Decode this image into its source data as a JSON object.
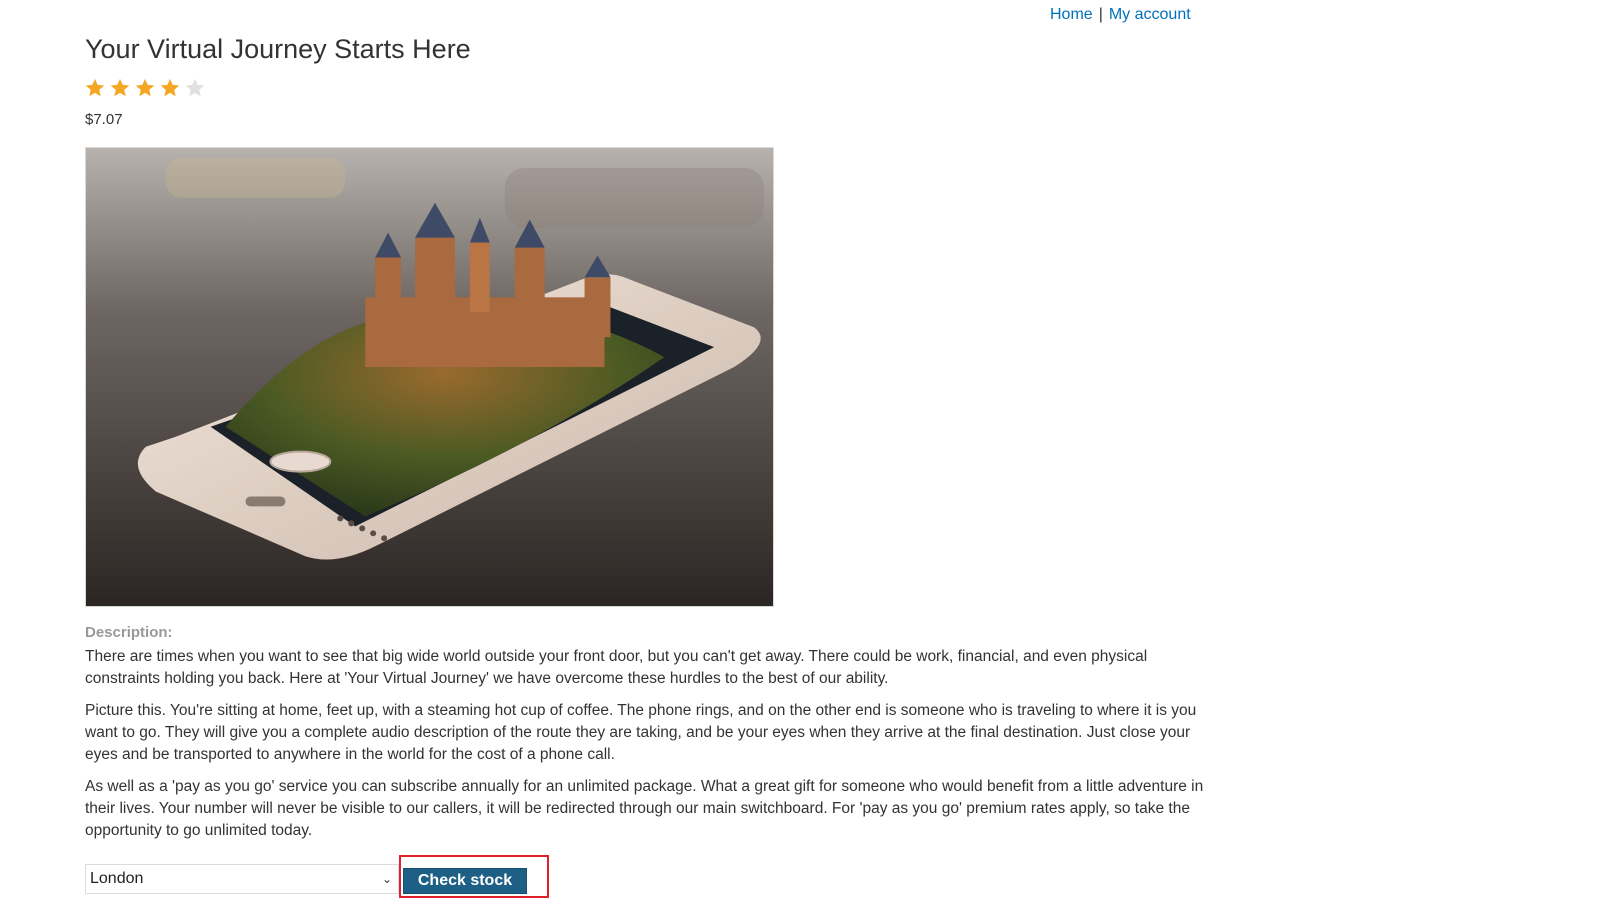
{
  "nav": {
    "home": "Home",
    "separator": "|",
    "account": "My account"
  },
  "product": {
    "title": "Your Virtual Journey Starts Here",
    "rating": 4,
    "rating_max": 5,
    "price": "$7.07",
    "image_subject": "castle-on-smartphone-image"
  },
  "description": {
    "label": "Description:",
    "paragraphs": [
      "There are times when you want to see that big wide world outside your front door, but you can't get away. There could be work, financial, and even physical constraints holding you back. Here at 'Your Virtual Journey' we have overcome these hurdles to the best of our ability.",
      "Picture this. You're sitting at home, feet up, with a steaming hot cup of coffee. The phone rings, and on the other end is someone who is traveling to where it is you want to go. They will give you a complete audio description of the route they are taking, and be your eyes when they arrive at the final destination. Just close your eyes and be transported to anywhere in the world for the cost of a phone call.",
      "As well as a 'pay as you go' service you can subscribe annually for an unlimited package. What a great gift for someone who would benefit from a little adventure in their lives. Your number will never be visible to our callers, it will be redirected through our main switchboard. For 'pay as you go' premium rates apply, so take the opportunity to go unlimited today."
    ]
  },
  "stock": {
    "selected_store": "London",
    "button_label": "Check stock"
  },
  "colors": {
    "link": "#0071bc",
    "star_filled": "#f5a623",
    "star_empty": "#e0e0e0",
    "button": "#1e5f86",
    "highlight": "#e0202a"
  }
}
